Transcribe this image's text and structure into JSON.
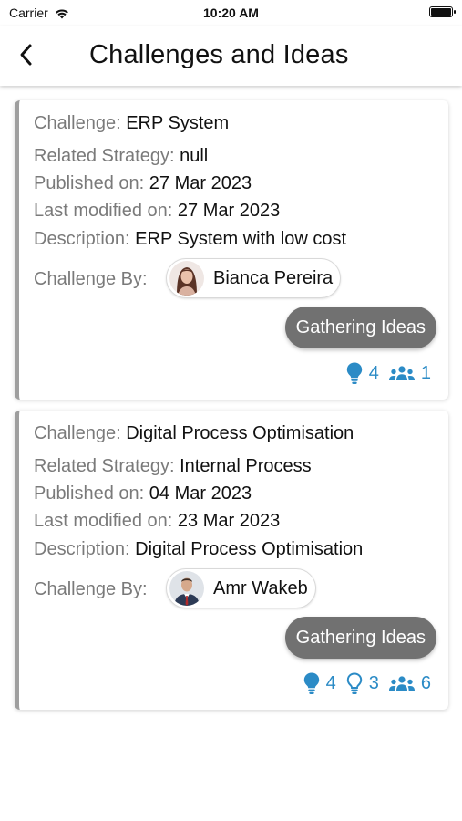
{
  "status_bar": {
    "carrier": "Carrier",
    "time": "10:20 AM"
  },
  "header": {
    "title": "Challenges and Ideas"
  },
  "labels": {
    "challenge": "Challenge:",
    "strategy": "Related Strategy:",
    "published": "Published on:",
    "modified": "Last modified on:",
    "description": "Description:",
    "challenge_by": "Challenge By:"
  },
  "colors": {
    "accent": "#2b8bc6",
    "status_pill": "#717171",
    "card_border": "#9e9e9e"
  },
  "cards": [
    {
      "challenge": "ERP System",
      "strategy": "null",
      "published": "27 Mar 2023",
      "modified": "27 Mar 2023",
      "description": "ERP System with low cost",
      "author": "Bianca Pereira",
      "status": "Gathering Ideas",
      "stats": {
        "ideas": "4",
        "participants": "1"
      }
    },
    {
      "challenge": "Digital Process Optimisation",
      "strategy": "Internal Process",
      "published": "04 Mar 2023",
      "modified": "23 Mar 2023",
      "description": "Digital Process Optimisation",
      "author": "Amr Wakeb",
      "status": "Gathering Ideas",
      "stats": {
        "ideas": "4",
        "open_ideas": "3",
        "participants": "6"
      }
    }
  ]
}
